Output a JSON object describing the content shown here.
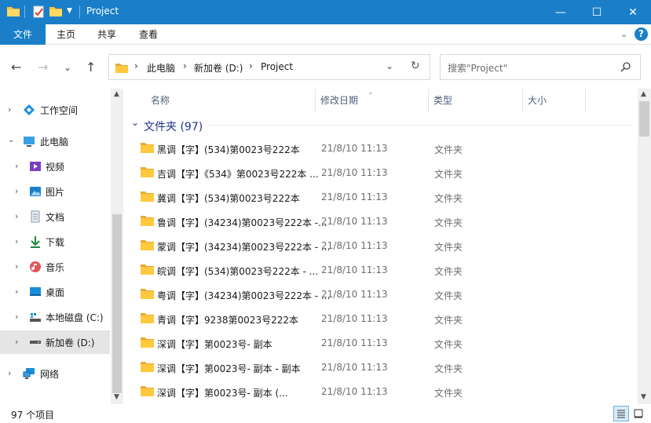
{
  "window": {
    "title": "Project",
    "minimize_glyph": "—",
    "maximize_glyph": "☐",
    "close_glyph": "✕"
  },
  "ribbon": {
    "tabs": [
      "文件",
      "主页",
      "共享",
      "查看"
    ],
    "help_glyph": "?"
  },
  "address": {
    "path": [
      "此电脑",
      "新加卷 (D:)",
      "Project"
    ]
  },
  "search": {
    "placeholder": "搜索\"Project\""
  },
  "sidebar": {
    "items": [
      {
        "label": "工作空间",
        "icon": "workspace-icon"
      },
      {
        "label": "此电脑",
        "icon": "this-pc-icon"
      },
      {
        "label": "视频",
        "icon": "video-icon"
      },
      {
        "label": "图片",
        "icon": "pictures-icon"
      },
      {
        "label": "文档",
        "icon": "documents-icon"
      },
      {
        "label": "下载",
        "icon": "download-icon"
      },
      {
        "label": "音乐",
        "icon": "music-icon"
      },
      {
        "label": "桌面",
        "icon": "desktop-icon"
      },
      {
        "label": "本地磁盘 (C:)",
        "icon": "drive-c-icon"
      },
      {
        "label": "新加卷 (D:)",
        "icon": "drive-d-icon"
      },
      {
        "label": "网络",
        "icon": "network-icon"
      }
    ]
  },
  "columns": {
    "name": "名称",
    "date": "修改日期",
    "type": "类型",
    "size": "大小"
  },
  "group": {
    "label": "文件夹 (97)"
  },
  "files": [
    {
      "name": "黑调【字】(534)第0023号222本",
      "date": "21/8/10 11:13",
      "type": "文件夹"
    },
    {
      "name": "吉调【字】《534》第0023号222本 ...",
      "date": "21/8/10 11:13",
      "type": "文件夹"
    },
    {
      "name": "冀调【字】(534)第0023号222本",
      "date": "21/8/10 11:13",
      "type": "文件夹"
    },
    {
      "name": "鲁调【字】(34234)第0023号222本 -...",
      "date": "21/8/10 11:13",
      "type": "文件夹"
    },
    {
      "name": "蒙调【字】(34234)第0023号222本 - ...",
      "date": "21/8/10 11:13",
      "type": "文件夹"
    },
    {
      "name": "皖调【字】(534)第0023号222本 - ...",
      "date": "21/8/10 11:13",
      "type": "文件夹"
    },
    {
      "name": "粤调【字】(34234)第0023号222本 - ...",
      "date": "21/8/10 11:13",
      "type": "文件夹"
    },
    {
      "name": "青调【字】9238第0023号222本",
      "date": "21/8/10 11:13",
      "type": "文件夹"
    },
    {
      "name": "深调【字】第0023号- 副本",
      "date": "21/8/10 11:13",
      "type": "文件夹"
    },
    {
      "name": "深调【字】第0023号- 副本 - 副本",
      "date": "21/8/10 11:13",
      "type": "文件夹"
    },
    {
      "name": "深调【字】第0023号- 副本 (...",
      "date": "21/8/10 11:13",
      "type": "文件夹"
    }
  ],
  "status": {
    "count": "97 个项目"
  },
  "colors": {
    "accent": "#1a7fc8",
    "folder": "#ffc83d",
    "selected": "#e5e5e5",
    "group_text": "#1e3287"
  }
}
